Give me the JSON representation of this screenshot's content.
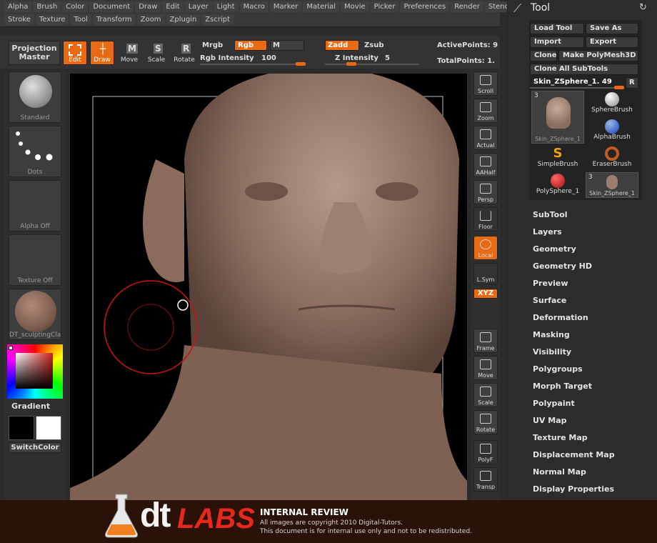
{
  "menubar": {
    "row1": [
      "Alpha",
      "Brush",
      "Color",
      "Document",
      "Draw",
      "Edit",
      "Layer",
      "Light",
      "Macro",
      "Marker",
      "Material",
      "Movie",
      "Picker",
      "Preferences",
      "Render",
      "Stencil"
    ],
    "row2": [
      "Stroke",
      "Texture",
      "Tool",
      "Transform",
      "Zoom",
      "Zplugin",
      "Zscript"
    ]
  },
  "toolbar": {
    "projection_master": "Projection Master",
    "edit": "Edit",
    "draw": "Draw",
    "move": "Move",
    "scale": "Scale",
    "rotate": "Rotate",
    "mrgb": "Mrgb",
    "rgb": "Rgb",
    "m": "M",
    "rgb_intensity_label": "Rgb Intensity",
    "rgb_intensity_value": "100",
    "zadd": "Zadd",
    "zsub": "Zsub",
    "z_intensity_label": "Z Intensity",
    "z_intensity_value": "5",
    "active_points": "ActivePoints: 9",
    "total_points": "TotalPoints: 1."
  },
  "left_shelf": {
    "brush": "Standard",
    "stroke": "Dots",
    "alpha": "Alpha Off",
    "texture": "Texture Off",
    "material": "DT_sculptingClay",
    "gradient": "Gradient",
    "switch_color": "SwitchColor"
  },
  "right_shelf": [
    "Scroll",
    "Zoom",
    "Actual",
    "AAHalf",
    "Persp",
    "Floor",
    "Local",
    "L.Sym",
    "Frame",
    "Move",
    "Scale",
    "Rotate",
    "PolyF",
    "Transp"
  ],
  "xyz": "XYZ",
  "tool_panel": {
    "title": "Tool",
    "load_tool": "Load Tool",
    "save_as": "Save As",
    "import": "Import",
    "export": "Export",
    "clone": "Clone",
    "make_polymesh": "Make PolyMesh3D",
    "clone_all": "Clone All SubTools",
    "current_tool": "Skin_ZSphere_1. 49",
    "r": "R",
    "thumb_count_1": "3",
    "thumb_count_2": "3",
    "tools": [
      "Skin_ZSphere_1",
      "SphereBrush",
      "AlphaBrush",
      "SimpleBrush",
      "EraserBrush",
      "PolySphere_1",
      "Skin_ZSphere_1"
    ],
    "menu": [
      "SubTool",
      "Layers",
      "Geometry",
      "Geometry HD",
      "Preview",
      "Surface",
      "Deformation",
      "Masking",
      "Visibility",
      "Polygroups",
      "Morph Target",
      "Polypaint",
      "UV Map",
      "Texture Map",
      "Displacement Map",
      "Normal Map",
      "Display Properties"
    ]
  },
  "footer": {
    "logo_dt": "dt",
    "logo_labs": "LABS",
    "title": "INTERNAL REVIEW",
    "line1": "All images are copyright 2010 Digital-Tutors.",
    "line2": "This document is for internal use only and not to be redistributed."
  },
  "colors": {
    "accent": "#e86b14",
    "brush_ring": "#d01010"
  }
}
